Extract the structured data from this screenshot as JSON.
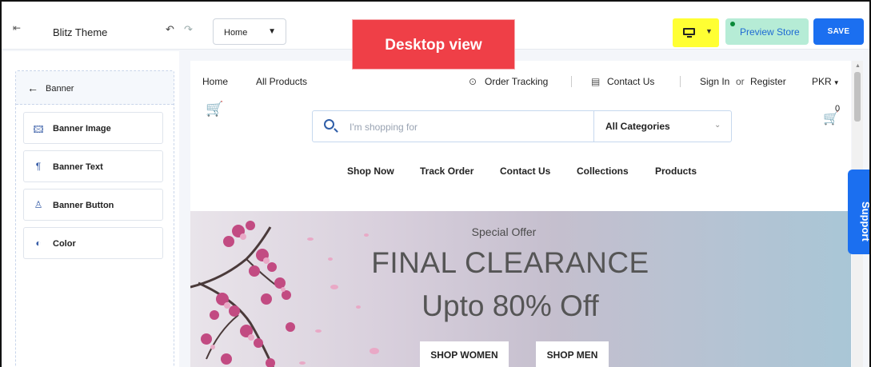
{
  "app": {
    "theme_name": "Blitz Theme",
    "page_select_value": "Home",
    "overlay_label": "Desktop view",
    "preview_label": "Preview Store",
    "save_label": "SAVE",
    "support_label": "Support",
    "colors": {
      "accent_blue": "#1b6ff0",
      "overlay_red": "#ef3f47",
      "device_highlight": "#ffff33",
      "preview_green": "#b6ecd6"
    },
    "icons": {
      "exit": "exit-icon",
      "undo": "undo-icon",
      "redo": "redo-icon",
      "device": "monitor-icon"
    }
  },
  "sidebar": {
    "header": "Banner",
    "items": [
      {
        "label": "Banner Image",
        "icon": "image-icon"
      },
      {
        "label": "Banner Text",
        "icon": "paragraph-icon"
      },
      {
        "label": "Banner Button",
        "icon": "button-icon"
      },
      {
        "label": "Color",
        "icon": "palette-icon"
      }
    ]
  },
  "store": {
    "nav": {
      "home": "Home",
      "all_products": "All Products",
      "order_tracking": "Order Tracking",
      "contact_us": "Contact Us",
      "sign_in": "Sign In",
      "or": "or",
      "register": "Register",
      "currency": "PKR"
    },
    "search": {
      "placeholder": "I'm shopping for",
      "category": "All Categories"
    },
    "cart_count": "0",
    "menu": [
      "Shop Now",
      "Track Order",
      "Contact Us",
      "Collections",
      "Products"
    ],
    "hero": {
      "subtitle": "Special Offer",
      "title": "FINAL CLEARANCE",
      "offer": "Upto 80% Off",
      "buttons": [
        "SHOP WOMEN",
        "SHOP MEN"
      ]
    }
  }
}
